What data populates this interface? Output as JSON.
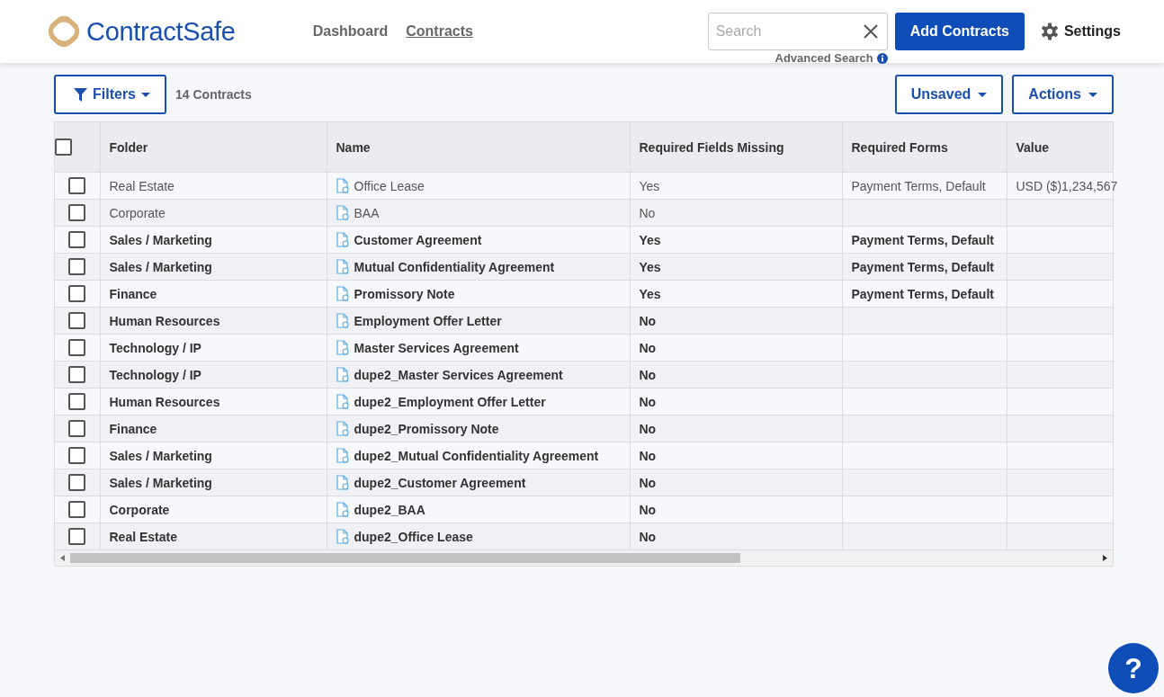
{
  "header": {
    "brand": "ContractSafe",
    "nav": [
      {
        "label": "Dashboard",
        "selected": false
      },
      {
        "label": "Contracts",
        "selected": true
      }
    ],
    "search": {
      "placeholder": "Search"
    },
    "advanced_search": "Advanced Search",
    "add_button": "Add Contracts",
    "settings": "Settings"
  },
  "toolbar": {
    "filters": "Filters",
    "count": "14 Contracts",
    "view": "Unsaved",
    "actions": "Actions"
  },
  "table": {
    "select_all_checked": false,
    "columns": [
      "Folder",
      "Name",
      "Required Fields Missing",
      "Required Forms",
      "Value"
    ],
    "rows": [
      {
        "checked": false,
        "unread": false,
        "folder": "Real Estate",
        "name": "Office Lease",
        "missing": "Yes",
        "forms": "Payment Terms, Default",
        "value": "USD ($)1,234,567"
      },
      {
        "checked": false,
        "unread": false,
        "folder": "Corporate",
        "name": "BAA",
        "missing": "No"
      },
      {
        "checked": false,
        "unread": true,
        "folder": "Sales / Marketing",
        "name": "Customer Agreement",
        "missing": "Yes",
        "forms": "Payment Terms, Default"
      },
      {
        "checked": false,
        "unread": true,
        "folder": "Sales / Marketing",
        "name": "Mutual Confidentiality Agreement",
        "missing": "Yes",
        "forms": "Payment Terms, Default"
      },
      {
        "checked": false,
        "unread": true,
        "folder": "Finance",
        "name": "Promissory Note",
        "missing": "Yes",
        "forms": "Payment Terms, Default"
      },
      {
        "checked": false,
        "unread": true,
        "folder": "Human Resources",
        "name": "Employment Offer Letter",
        "missing": "No"
      },
      {
        "checked": false,
        "unread": true,
        "folder": "Technology / IP",
        "name": "Master Services Agreement",
        "missing": "No"
      },
      {
        "checked": false,
        "unread": true,
        "folder": "Technology / IP",
        "name": "dupe2_Master Services Agreement",
        "missing": "No"
      },
      {
        "checked": false,
        "unread": true,
        "folder": "Human Resources",
        "name": "dupe2_Employment Offer Letter",
        "missing": "No"
      },
      {
        "checked": false,
        "unread": true,
        "folder": "Finance",
        "name": "dupe2_Promissory Note",
        "missing": "No"
      },
      {
        "checked": false,
        "unread": true,
        "folder": "Sales / Marketing",
        "name": "dupe2_Mutual Confidentiality Agreement",
        "missing": "No"
      },
      {
        "checked": false,
        "unread": true,
        "folder": "Sales / Marketing",
        "name": "dupe2_Customer Agreement",
        "missing": "No"
      },
      {
        "checked": false,
        "unread": true,
        "folder": "Corporate",
        "name": "dupe2_BAA",
        "missing": "No"
      },
      {
        "checked": false,
        "unread": true,
        "folder": "Real Estate",
        "name": "dupe2_Office Lease",
        "missing": "No"
      }
    ]
  },
  "help": "?"
}
